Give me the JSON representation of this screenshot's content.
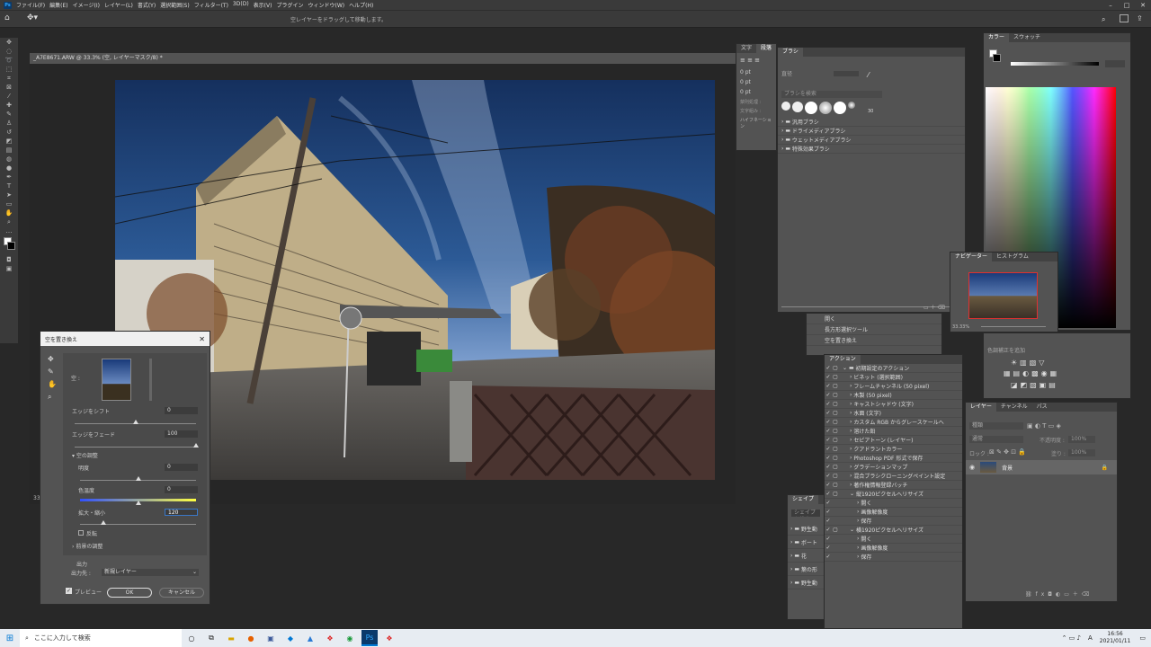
{
  "menu": [
    "ファイル(F)",
    "編集(E)",
    "イメージ(I)",
    "レイヤー(L)",
    "書式(Y)",
    "選択範囲(S)",
    "フィルター(T)",
    "3D(D)",
    "表示(V)",
    "プラグイン",
    "ウィンドウ(W)",
    "ヘルプ(H)"
  ],
  "options_hint": "空レイヤーをドラッグして移動します。",
  "doc_tab": "_A7E8671.ARW @ 33.3% (空, レイヤーマスク/8) *",
  "zoom": "33.3",
  "dialog": {
    "title": "空を置き換え",
    "sky_label": "空 :",
    "edge_shift_label": "エッジをシフト",
    "edge_shift_value": "0",
    "edge_shift_pos": 0.5,
    "edge_fade_label": "エッジをフェード",
    "edge_fade_value": "100",
    "edge_fade_pos": 1.0,
    "sky_adjust_label": "空の調整",
    "brightness_label": "明度",
    "brightness_value": "0",
    "brightness_pos": 0.5,
    "temperature_label": "色温度",
    "temperature_value": "0",
    "temperature_pos": 0.5,
    "scale_label": "拡大・縮小",
    "scale_value": "120",
    "scale_pos": 0.2,
    "flip_label": "反転",
    "fg_adjust_label": "前景の調整",
    "output_label": "出力",
    "output_to_label": "出力先 :",
    "output_to_value": "新規レイヤー",
    "preview_label": "プレビュー",
    "ok_label": "OK",
    "cancel_label": "キャンセル"
  },
  "text_panel": {
    "tab1": "文字",
    "tab2": "段落",
    "f1": "0 pt",
    "f2": "0 pt",
    "f3": "0 pt",
    "l1": "禁則処理 :",
    "l2": "文字組み :",
    "l3": "ハイフネーション"
  },
  "brush_panel": {
    "tab": "ブラシ",
    "size_label": "直径",
    "search_placeholder": "ブラシを検索",
    "brush_size": "30",
    "folders": [
      "汎用ブラシ",
      "ドライメディアブラシ",
      "ウェットメディアブラシ",
      "特殊効果ブラシ"
    ]
  },
  "color_panel": {
    "tab1": "カラー",
    "tab2": "スウォッチ"
  },
  "navigator": {
    "tab1": "ナビゲーター",
    "tab2": "ヒストグラム",
    "zoom": "33.33%"
  },
  "adjust_panel": {
    "hint": "色調補正を追加"
  },
  "history_items": [
    "開く",
    "長方形選択ツール",
    "空を置き換え"
  ],
  "actions": {
    "tab": "アクション",
    "items": [
      {
        "indent": 0,
        "label": "初期設定のアクション",
        "type": "folder"
      },
      {
        "indent": 1,
        "label": "ビネット (選択範囲)"
      },
      {
        "indent": 1,
        "label": "フレームチャンネル (50 pixel)"
      },
      {
        "indent": 1,
        "label": "木製 (50 pixel)"
      },
      {
        "indent": 1,
        "label": "キャストシャドウ (文字)"
      },
      {
        "indent": 1,
        "label": "水面 (文字)"
      },
      {
        "indent": 1,
        "label": "カスタム RGB からグレースケールへ"
      },
      {
        "indent": 1,
        "label": "溶けた鉛"
      },
      {
        "indent": 1,
        "label": "セピアトーン (レイヤー)"
      },
      {
        "indent": 1,
        "label": "クアドラントカラー"
      },
      {
        "indent": 1,
        "label": "Photoshop PDF 形式で保存"
      },
      {
        "indent": 1,
        "label": "グラデーションマップ"
      },
      {
        "indent": 1,
        "label": "混合ブラシクローニングペイント設定"
      },
      {
        "indent": 1,
        "label": "著作権情報登録バッチ"
      },
      {
        "indent": 1,
        "label": "縦1920ピクセルへリサイズ",
        "open": true
      },
      {
        "indent": 2,
        "label": "開く"
      },
      {
        "indent": 2,
        "label": "画像解像度"
      },
      {
        "indent": 2,
        "label": "保存"
      },
      {
        "indent": 1,
        "label": "横1920ピクセルへリサイズ",
        "open": true
      },
      {
        "indent": 2,
        "label": "開く"
      },
      {
        "indent": 2,
        "label": "画像解像度"
      },
      {
        "indent": 2,
        "label": "保存"
      }
    ]
  },
  "shapes": {
    "tab": "シェイプ",
    "search_placeholder": "シェイプを検索",
    "folders": [
      "野生動",
      "ボート",
      "花",
      "葉の形",
      "野生動"
    ]
  },
  "layers": {
    "tab1": "レイヤー",
    "tab2": "チャンネル",
    "tab3": "パス",
    "kind": "種類",
    "mode": "通常",
    "opacity_label": "不透明度 :",
    "opacity": "100%",
    "lock_label": "ロック :",
    "fill_label": "塗り :",
    "fill": "100%",
    "layer_name": "背景"
  },
  "taskbar": {
    "search_placeholder": "ここに入力して検索",
    "time": "16:56",
    "date": "2021/01/11",
    "ime": "A"
  }
}
